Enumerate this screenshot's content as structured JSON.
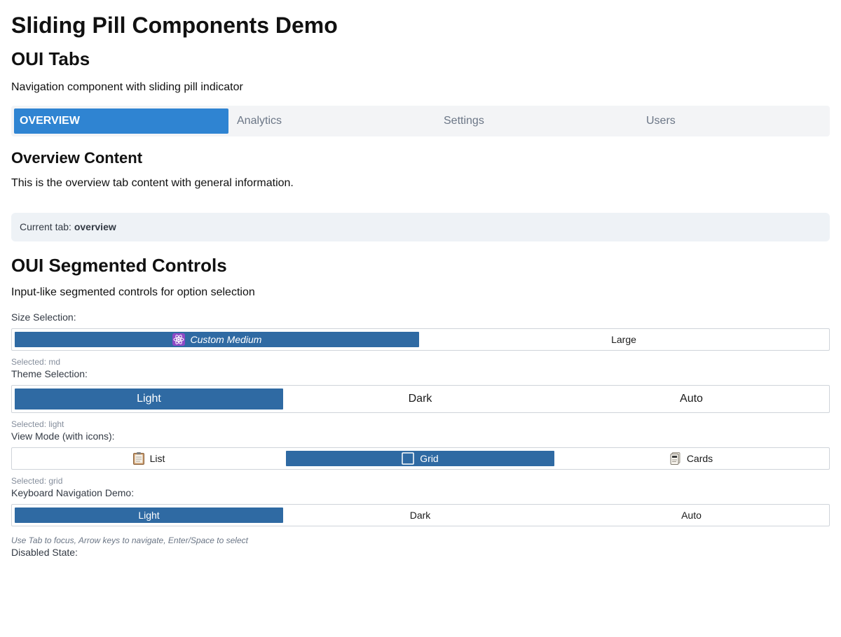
{
  "page_title": "Sliding Pill Components Demo",
  "tabs_section": {
    "heading": "OUI Tabs",
    "description": "Navigation component with sliding pill indicator",
    "tabs": [
      {
        "label": "OVERVIEW",
        "active": true
      },
      {
        "label": "Analytics",
        "active": false
      },
      {
        "label": "Settings",
        "active": false
      },
      {
        "label": "Users",
        "active": false
      }
    ],
    "content_heading": "Overview Content",
    "content_text": "This is the overview tab content with general information.",
    "current_tab_label": "Current tab:",
    "current_tab_value": "overview"
  },
  "segmented_section": {
    "heading": "OUI Segmented Controls",
    "description": "Input-like segmented controls for option selection",
    "size": {
      "label": "Size Selection:",
      "options": [
        {
          "label": "Custom Medium",
          "icon": "atom-icon",
          "active": true
        },
        {
          "label": "Large",
          "active": false
        }
      ],
      "selected_text": "Selected: md"
    },
    "theme": {
      "label": "Theme Selection:",
      "options": [
        {
          "label": "Light",
          "active": true
        },
        {
          "label": "Dark",
          "active": false
        },
        {
          "label": "Auto",
          "active": false
        }
      ],
      "selected_text": "Selected: light"
    },
    "view": {
      "label": "View Mode (with icons):",
      "options": [
        {
          "label": "List",
          "icon": "clipboard-icon",
          "active": false
        },
        {
          "label": "Grid",
          "icon": "square-icon",
          "active": true
        },
        {
          "label": "Cards",
          "icon": "cards-icon",
          "active": false
        }
      ],
      "selected_text": "Selected: grid"
    },
    "keyboard": {
      "label": "Keyboard Navigation Demo:",
      "options": [
        {
          "label": "Light",
          "active": true
        },
        {
          "label": "Dark",
          "active": false
        },
        {
          "label": "Auto",
          "active": false
        }
      ],
      "hint": "Use Tab to focus, Arrow keys to navigate, Enter/Space to select"
    },
    "disabled_label": "Disabled State:"
  },
  "colors": {
    "tab_active": "#2f84d2",
    "segment_active": "#2f6aa3",
    "tabs_bg": "#f3f4f6",
    "info_box_bg": "#eef2f6"
  }
}
